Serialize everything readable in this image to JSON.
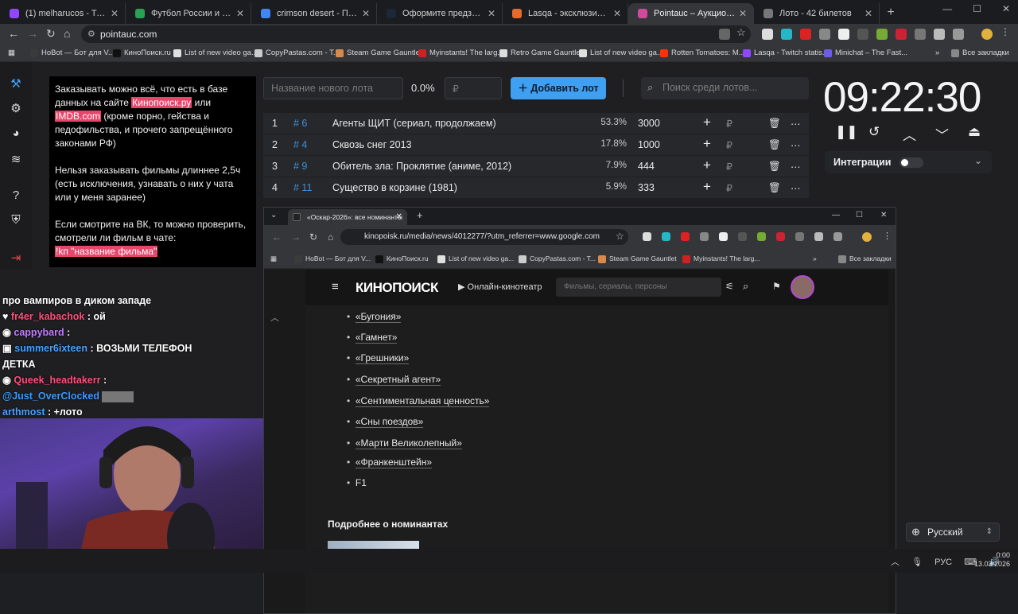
{
  "browser": {
    "tabs": [
      {
        "title": "(1) melharucos - Twitch",
        "fav": "#9146ff"
      },
      {
        "title": "Футбол России и мира 2026 -",
        "fav": "#2aa052"
      },
      {
        "title": "crimson desert - Поиск в Goo",
        "fav": "#4285f4"
      },
      {
        "title": "Оформите предзаказ на Crim",
        "fav": "#1b2838"
      },
      {
        "title": "Lasqa - эксклюзивный контен",
        "fav": "#e66a2c"
      },
      {
        "title": "Pointauc – Аукционы, лотерея",
        "fav": "#d04a9b"
      },
      {
        "title": "Лото - 42 билетов",
        "fav": "#777777"
      }
    ],
    "url": "pointauc.com",
    "bookmarks": [
      {
        "label": "HoBot — Бот для V...",
        "fav": "#3b3b3b"
      },
      {
        "label": "КиноПоиск.ru",
        "fav": "#111111"
      },
      {
        "label": "List of new video ga...",
        "fav": "#e0e0e0"
      },
      {
        "label": "CopyPastas.com - T...",
        "fav": "#cccccc"
      },
      {
        "label": "Steam Game Gauntlet",
        "fav": "#d9894a"
      },
      {
        "label": "Myinstants! The larg...",
        "fav": "#cc2222"
      },
      {
        "label": "Retro Game Gauntlet",
        "fav": "#dddddd"
      },
      {
        "label": "List of new video ga...",
        "fav": "#e0e0e0"
      },
      {
        "label": "Rotten Tomatoes: M...",
        "fav": "#fa320a"
      },
      {
        "label": "Lasqa - Twitch statis...",
        "fav": "#9146ff"
      },
      {
        "label": "Minichat – The Fast...",
        "fav": "#6c5ce7"
      }
    ],
    "all_bookmarks": "Все закладки"
  },
  "info_panel": {
    "p1_a": "Заказывать можно всё, что есть в базе данных на сайте ",
    "p1_link1": "Кинопоиск.ру",
    "p1_b": " или ",
    "p1_link2": "IMDB.com",
    "p1_c": " (кроме порно, гейства и педофильства, и прочего запрещённого законами РФ)",
    "p2": "Нельзя заказывать фильмы длиннее 2,5ч (есть исключения, узнавать о них у чата или у меня заранее)",
    "p3": "Если смотрите на ВК, то можно проверить, смотрели ли фильм в чате:",
    "p3_cmd": "!kп \"название фильма\""
  },
  "auction": {
    "lot_name_placeholder": "Название нового лота",
    "percent": "0.0%",
    "price_placeholder": "₽",
    "add_button": "Добавить лот",
    "search_placeholder": "Поиск среди лотов...",
    "lots": [
      {
        "n": "1",
        "id": "# 6",
        "name": "Агенты ЩИТ (сериал, продолжаем)",
        "pct": "53.3%",
        "amount": "3000"
      },
      {
        "n": "2",
        "id": "# 4",
        "name": "Сквозь снег 2013",
        "pct": "17.8%",
        "amount": "1000"
      },
      {
        "n": "3",
        "id": "# 9",
        "name": "Обитель зла: Проклятие (аниме, 2012)",
        "pct": "7.9%",
        "amount": "444"
      },
      {
        "n": "4",
        "id": "# 11",
        "name": "Существо в корзине (1981)",
        "pct": "5.9%",
        "amount": "333"
      }
    ],
    "ruble": "₽"
  },
  "timer": {
    "value": "09:22:30"
  },
  "integrations": {
    "label": "Интеграции"
  },
  "chat": {
    "l0": "про вампиров в диком западе",
    "l1_user": "fr4er_kabachok",
    "l1_msg": ": ой",
    "l2_user": "cappybard",
    "l2_msg": ":",
    "l3_user": "summer6ixteen",
    "l3_msg": ": ВОЗЬМИ ТЕЛЕФОН",
    "l3b": "ДЕТКА",
    "l4_user": "Queek_headtakerr",
    "l4_msg": ":",
    "l5_user": "@Just_OverClocked",
    "l6_user": "arthmost",
    "l6_msg": ": +лото"
  },
  "inner": {
    "tab_title": "«Оскар-2026»: все номинанты",
    "url": "kinopoisk.ru/media/news/4012277/?utm_referrer=www.google.com",
    "bookmarks": [
      {
        "label": "HoBot — Бот для V...",
        "fav": "#3b3b3b"
      },
      {
        "label": "КиноПоиск.ru",
        "fav": "#111111"
      },
      {
        "label": "List of new video ga...",
        "fav": "#e0e0e0"
      },
      {
        "label": "CopyPastas.com - T...",
        "fav": "#cccccc"
      },
      {
        "label": "Steam Game Gauntlet",
        "fav": "#d9894a"
      },
      {
        "label": "Myinstants! The larg...",
        "fav": "#cc2222"
      }
    ],
    "all_bookmarks": "Все закладки",
    "logo": "КИНОПОИСК",
    "online": "Онлайн-кинотеатр",
    "search_placeholder": "Фильмы, сериалы, персоны",
    "films": [
      "«Бугония»",
      "«Гамнет»",
      "«Грешники»",
      "«Секретный агент»",
      "«Сентиментальная ценность»",
      "«Сны поездов»",
      "«Марти Великолепный»",
      "«Франкенштейн»",
      "F1"
    ],
    "more": "Подробнее о номинантах"
  },
  "lang": {
    "label": "Русский"
  },
  "tray": {
    "lang": "РУС",
    "time": "0:00",
    "date": "13.03.2026"
  }
}
